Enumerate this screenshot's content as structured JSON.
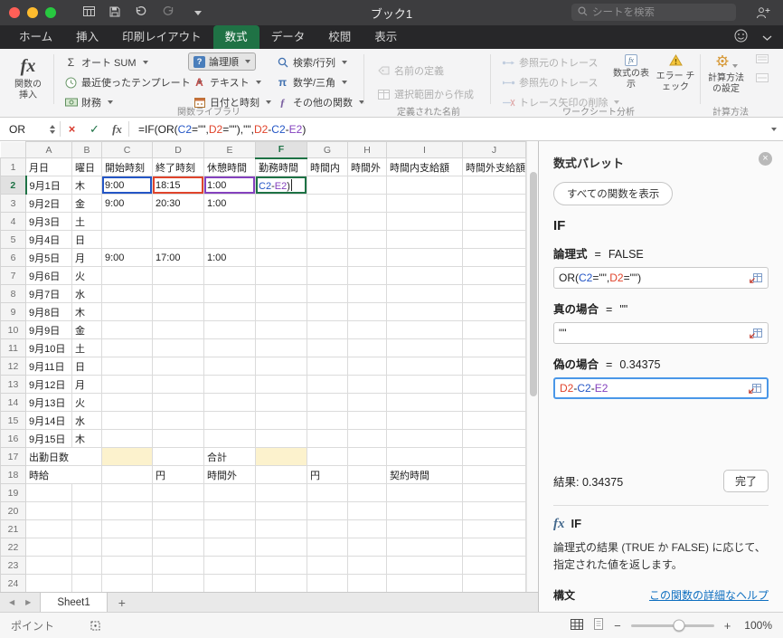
{
  "colors": {
    "accent_green": "#1E7245",
    "ref_blue": "#2456C6",
    "ref_red": "#E0442C",
    "ref_purple": "#8441BE",
    "highlight_yellow": "#FCF2CD",
    "link_blue": "#0E6FC0"
  },
  "titlebar": {
    "title": "ブック1",
    "search_placeholder": "シートを検索"
  },
  "ribbon_tabs": [
    {
      "label": "ホーム"
    },
    {
      "label": "挿入"
    },
    {
      "label": "印刷レイアウト"
    },
    {
      "label": "数式"
    },
    {
      "label": "データ"
    },
    {
      "label": "校閲"
    },
    {
      "label": "表示"
    }
  ],
  "ribbon": {
    "insert_function": "関数の挿入",
    "autosum": "オート SUM",
    "recent": "最近使ったテンプレート",
    "financial": "財務",
    "logical": "論理順",
    "text_fns": "テキスト",
    "datetime": "日付と時刻",
    "lookup": "検索/行列",
    "math": "数学/三角",
    "more_fns": "その他の関数",
    "library_label": "関数ライブラリ",
    "define_name": "名前の定義",
    "from_selection": "選択範囲から作成",
    "names_label": "定義された名前",
    "trace_precedents": "参照元のトレース",
    "trace_dependents": "参照先のトレース",
    "remove_arrows": "トレース矢印の削除",
    "show_formulas": "数式の表示",
    "error_check": "エラー チェック",
    "audit_label": "ワークシート分析",
    "calc_settings": "計算方法の設定",
    "calc_label": "計算方法"
  },
  "formula_bar": {
    "name_box": "OR",
    "formula_parts": [
      {
        "t": "=IF(OR("
      },
      {
        "t": "C2",
        "c": "#2456C6"
      },
      {
        "t": "=\"\","
      },
      {
        "t": "D2",
        "c": "#E0442C"
      },
      {
        "t": "=\"\")"
      },
      {
        "t": ",\"\","
      },
      {
        "t": "D2",
        "c": "#E0442C"
      },
      {
        "t": "-"
      },
      {
        "t": "C2",
        "c": "#2456C6"
      },
      {
        "t": "-"
      },
      {
        "t": "E2",
        "c": "#8441BE"
      },
      {
        "t": ")"
      }
    ]
  },
  "grid": {
    "col_headers": [
      "A",
      "B",
      "C",
      "D",
      "E",
      "F",
      "G",
      "H",
      "I",
      "J"
    ],
    "active_col": "F",
    "active_row": 2,
    "row_count": 24,
    "rows": [
      {
        "n": 1,
        "cells": [
          {
            "c": "A",
            "t": "月日",
            "al": "c"
          },
          {
            "c": "B",
            "t": "曜日",
            "al": "c"
          },
          {
            "c": "C",
            "t": "開始時刻",
            "al": "c"
          },
          {
            "c": "D",
            "t": "終了時刻",
            "al": "c"
          },
          {
            "c": "E",
            "t": "休憩時間",
            "al": "c"
          },
          {
            "c": "F",
            "t": "勤務時間",
            "al": "c"
          },
          {
            "c": "G",
            "t": "時間内",
            "al": "c"
          },
          {
            "c": "H",
            "t": "時間外",
            "al": "c"
          },
          {
            "c": "I",
            "t": "時間内支給額",
            "al": "c"
          },
          {
            "c": "J",
            "t": "時間外支給額",
            "al": "c"
          }
        ]
      },
      {
        "n": 2,
        "cells": [
          {
            "c": "A",
            "t": "9月1日",
            "al": "r"
          },
          {
            "c": "B",
            "t": "木",
            "al": "c"
          },
          {
            "c": "C",
            "t": "9:00",
            "al": "r",
            "ref": "blue"
          },
          {
            "c": "D",
            "t": "18:15",
            "al": "r",
            "ref": "red"
          },
          {
            "c": "E",
            "t": "1:00",
            "al": "r",
            "ref": "purple"
          },
          {
            "c": "F",
            "edit": true,
            "parts": [
              {
                "t": "C2",
                "c": "#2456C6"
              },
              {
                "t": "-"
              },
              {
                "t": "E2",
                "c": "#8441BE"
              },
              {
                "t": ")"
              }
            ]
          }
        ]
      },
      {
        "n": 3,
        "cells": [
          {
            "c": "A",
            "t": "9月2日",
            "al": "r"
          },
          {
            "c": "B",
            "t": "金",
            "al": "c"
          },
          {
            "c": "C",
            "t": "9:00",
            "al": "r"
          },
          {
            "c": "D",
            "t": "20:30",
            "al": "r"
          },
          {
            "c": "E",
            "t": "1:00",
            "al": "r"
          }
        ]
      },
      {
        "n": 4,
        "cells": [
          {
            "c": "A",
            "t": "9月3日",
            "al": "r"
          },
          {
            "c": "B",
            "t": "土",
            "al": "c"
          }
        ]
      },
      {
        "n": 5,
        "cells": [
          {
            "c": "A",
            "t": "9月4日",
            "al": "r"
          },
          {
            "c": "B",
            "t": "日",
            "al": "c"
          }
        ]
      },
      {
        "n": 6,
        "cells": [
          {
            "c": "A",
            "t": "9月5日",
            "al": "r"
          },
          {
            "c": "B",
            "t": "月",
            "al": "c"
          },
          {
            "c": "C",
            "t": "9:00",
            "al": "r"
          },
          {
            "c": "D",
            "t": "17:00",
            "al": "r"
          },
          {
            "c": "E",
            "t": "1:00",
            "al": "r"
          }
        ]
      },
      {
        "n": 7,
        "cells": [
          {
            "c": "A",
            "t": "9月6日",
            "al": "r"
          },
          {
            "c": "B",
            "t": "火",
            "al": "c"
          }
        ]
      },
      {
        "n": 8,
        "cells": [
          {
            "c": "A",
            "t": "9月7日",
            "al": "r"
          },
          {
            "c": "B",
            "t": "水",
            "al": "c"
          }
        ]
      },
      {
        "n": 9,
        "cells": [
          {
            "c": "A",
            "t": "9月8日",
            "al": "r"
          },
          {
            "c": "B",
            "t": "木",
            "al": "c"
          }
        ]
      },
      {
        "n": 10,
        "cells": [
          {
            "c": "A",
            "t": "9月9日",
            "al": "r"
          },
          {
            "c": "B",
            "t": "金",
            "al": "c"
          }
        ]
      },
      {
        "n": 11,
        "cells": [
          {
            "c": "A",
            "t": "9月10日",
            "al": "r"
          },
          {
            "c": "B",
            "t": "土",
            "al": "c"
          }
        ]
      },
      {
        "n": 12,
        "cells": [
          {
            "c": "A",
            "t": "9月11日",
            "al": "r"
          },
          {
            "c": "B",
            "t": "日",
            "al": "c"
          }
        ]
      },
      {
        "n": 13,
        "cells": [
          {
            "c": "A",
            "t": "9月12日",
            "al": "r"
          },
          {
            "c": "B",
            "t": "月",
            "al": "c"
          }
        ]
      },
      {
        "n": 14,
        "cells": [
          {
            "c": "A",
            "t": "9月13日",
            "al": "r"
          },
          {
            "c": "B",
            "t": "火",
            "al": "c"
          }
        ]
      },
      {
        "n": 15,
        "cells": [
          {
            "c": "A",
            "t": "9月14日",
            "al": "r"
          },
          {
            "c": "B",
            "t": "水",
            "al": "c"
          }
        ]
      },
      {
        "n": 16,
        "cells": [
          {
            "c": "A",
            "t": "9月15日",
            "al": "r"
          },
          {
            "c": "B",
            "t": "木",
            "al": "c"
          }
        ]
      },
      {
        "n": 17,
        "cells": [
          {
            "c": "A",
            "t": "出勤日数",
            "al": "c",
            "span": 2
          },
          {
            "c": "C",
            "fill": "yellow"
          },
          {
            "c": "E",
            "t": "合計"
          },
          {
            "c": "F",
            "fill": "yellow"
          }
        ]
      },
      {
        "n": 18,
        "cells": [
          {
            "c": "A",
            "t": "時給",
            "al": "c",
            "span": 2
          },
          {
            "c": "D",
            "t": "円",
            "al": "r"
          },
          {
            "c": "E",
            "t": "時間外"
          },
          {
            "c": "G",
            "t": "円"
          },
          {
            "c": "I",
            "t": "契約時間",
            "al": "c"
          }
        ]
      }
    ]
  },
  "panel": {
    "title": "数式パレット",
    "show_all": "すべての関数を表示",
    "fn_name": "IF",
    "args": [
      {
        "label": "論理式",
        "eq": "=",
        "value": "FALSE",
        "input_parts": [
          {
            "t": "OR("
          },
          {
            "t": "C2",
            "c": "#2456C6"
          },
          {
            "t": "=\"\","
          },
          {
            "t": "D2",
            "c": "#E0442C"
          },
          {
            "t": "=\"\")"
          }
        ]
      },
      {
        "label": "真の場合",
        "eq": "=",
        "value": "\"\"",
        "input_parts": [
          {
            "t": "\"\""
          }
        ]
      },
      {
        "label": "偽の場合",
        "eq": "=",
        "value": "0.34375",
        "input_parts": [
          {
            "t": "D2",
            "c": "#E0442C"
          },
          {
            "t": "-"
          },
          {
            "t": "C2",
            "c": "#2456C6"
          },
          {
            "t": "-"
          },
          {
            "t": "E2",
            "c": "#8441BE"
          }
        ]
      }
    ],
    "result_label": "結果:",
    "result_value": "0.34375",
    "done": "完了",
    "about_fn": "IF",
    "description": "論理式の結果 (TRUE か FALSE) に応じて、指定された値を返します。",
    "syntax": "構文",
    "help_link": "この関数の詳細なヘルプ"
  },
  "sheet_tabs": {
    "active": "Sheet1"
  },
  "status_bar": {
    "mode": "ポイント",
    "zoom": "100%"
  }
}
